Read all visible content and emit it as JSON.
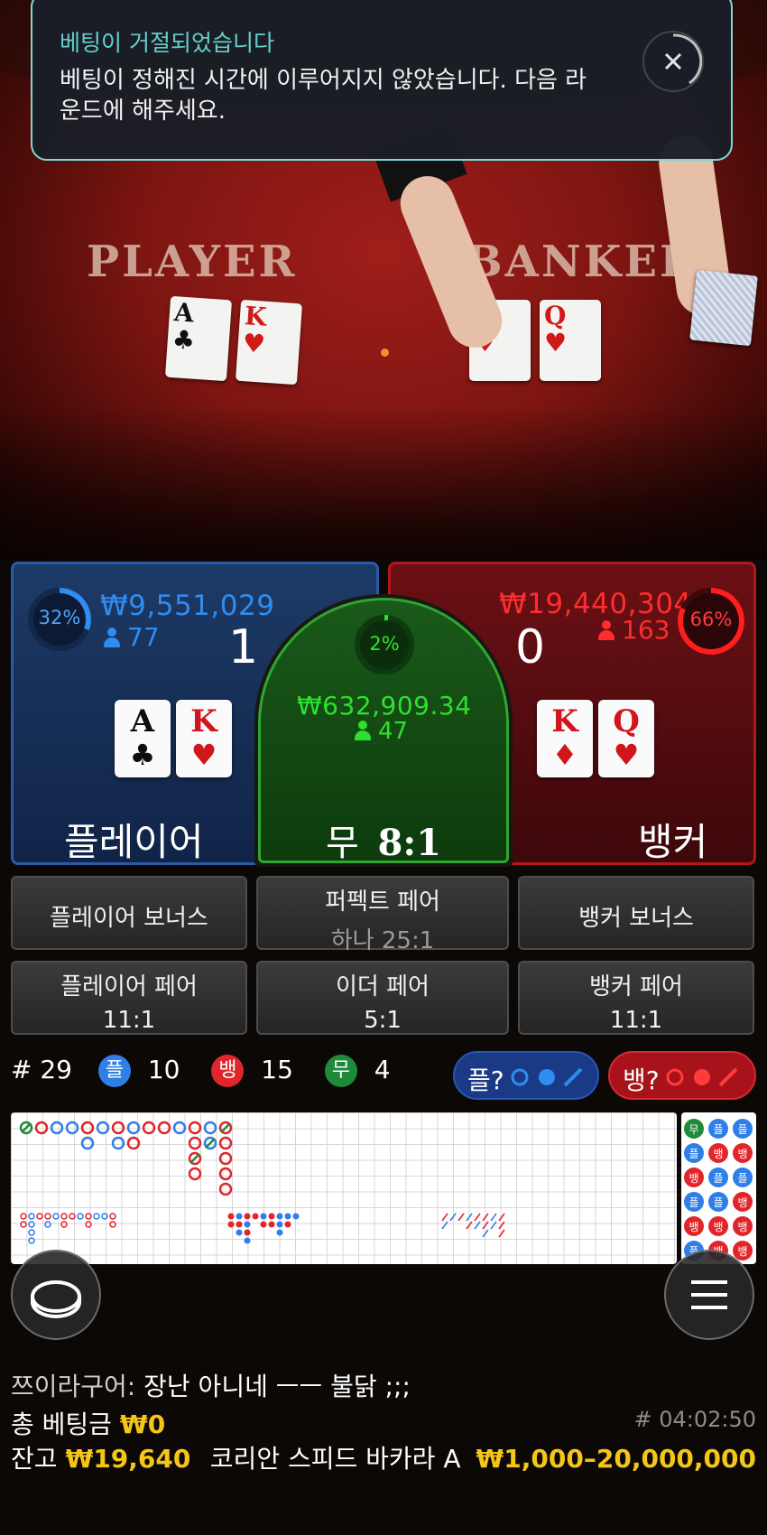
{
  "toast": {
    "title": "베팅이 거절되었습니다",
    "message": "베팅이 정해진 시간에 이루어지지 않았습니다. 다음 라운드에 해주세요."
  },
  "table": {
    "player_label": "PLAYER",
    "banker_label": "BANKER",
    "player_cards": [
      {
        "rank": "A",
        "suit": "♣"
      },
      {
        "rank": "K",
        "suit": "♥"
      }
    ],
    "banker_cards": [
      {
        "rank": "K",
        "suit": "♦"
      },
      {
        "rank": "Q",
        "suit": "♥"
      }
    ]
  },
  "player": {
    "percent": "32%",
    "amount": "₩9,551,029",
    "players": "77",
    "score": "1",
    "label": "플레이어",
    "cards": [
      {
        "rank": "A",
        "suit": "♣"
      },
      {
        "rank": "K",
        "suit": "♥"
      }
    ],
    "color": "#2f8cf0"
  },
  "tie": {
    "percent": "2%",
    "amount": "₩632,909.34",
    "players": "47",
    "label": "무",
    "payout": "8:1",
    "color": "#2ee02e"
  },
  "banker": {
    "percent": "66%",
    "amount": "₩19,440,304",
    "players": "163",
    "score": "0",
    "label": "뱅커",
    "cards": [
      {
        "rank": "K",
        "suit": "♦"
      },
      {
        "rank": "Q",
        "suit": "♥"
      }
    ],
    "color": "#ff2d2d"
  },
  "side_bets": {
    "player_bonus": "플레이어 보너스",
    "perfect_pair": "퍼펙트 페어",
    "perfect_pair_sub": "하나 25:1",
    "banker_bonus": "뱅커 보너스",
    "player_pair": "플레이어 페어",
    "player_pair_odds": "11:1",
    "either_pair": "이더 페어",
    "either_pair_odds": "5:1",
    "banker_pair": "뱅커 페어",
    "banker_pair_odds": "11:1"
  },
  "stats": {
    "round": "# 29",
    "p_badge": "플",
    "p_count": "10",
    "b_badge": "뱅",
    "b_count": "15",
    "t_badge": "무",
    "t_count": "4",
    "predict_player": "플?",
    "predict_banker": "뱅?"
  },
  "bead_road": [
    [
      "무",
      "플",
      "플"
    ],
    [
      "플",
      "뱅",
      "뱅"
    ],
    [
      "뱅",
      "플",
      "플"
    ],
    [
      "플",
      "플",
      "뱅"
    ],
    [
      "뱅",
      "뱅",
      "뱅"
    ],
    [
      "플",
      "뱅",
      "뱅"
    ]
  ],
  "chat": {
    "user": "쯔이라구어:",
    "message": "장난 아니네 ㅡㅡ 불닭 ;;;"
  },
  "footer": {
    "total_bet_label": "총 베팅금",
    "total_bet": "₩0",
    "game_id": "# 04:02:50",
    "balance_label": "잔고",
    "balance": "₩19,640",
    "table_name": "코리안 스피드 바카라 A",
    "limits": "₩1,000–20,000,000"
  }
}
